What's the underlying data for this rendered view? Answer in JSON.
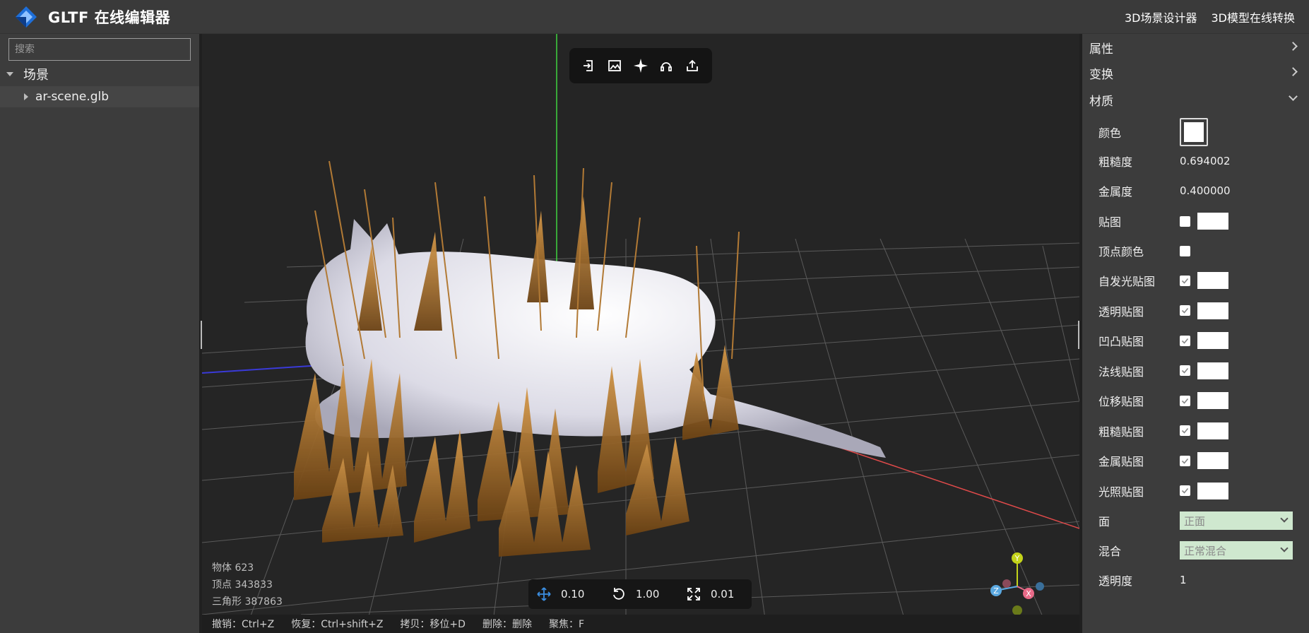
{
  "header": {
    "title": "GLTF 在线编辑器",
    "links": [
      "3D场景设计器",
      "3D模型在线转换"
    ]
  },
  "left_panel": {
    "search_placeholder": "搜索",
    "tree_root": "场景",
    "tree_child": "ar-scene.glb"
  },
  "viewport": {
    "toolbar_icons": [
      "import-icon",
      "image-upload-icon",
      "light-icon",
      "headset-icon",
      "export-icon"
    ],
    "stats": {
      "objects": "物体 623",
      "vertices": "顶点 343833",
      "triangles": "三角形 387863"
    },
    "snap": {
      "translate": "0.10",
      "rotate": "1.00",
      "scale": "0.01"
    },
    "shortcuts": [
      "撤销：Ctrl+Z",
      "恢复：Ctrl+shift+Z",
      "拷贝：移位+D",
      "删除：删除",
      "聚焦：F"
    ],
    "gizmo_labels": {
      "y": "Y",
      "z": "Z",
      "x": "X"
    },
    "axis_colors": {
      "x": "#e04a4a",
      "y": "#3fd43f",
      "z": "#3a3ad8"
    }
  },
  "right_panel": {
    "sections": {
      "attributes": "属性",
      "transform": "变换",
      "material": "材质"
    },
    "material": {
      "color_label": "颜色",
      "color_value": "#ffffff",
      "roughness_label": "粗糙度",
      "roughness_value": "0.694002",
      "metalness_label": "金属度",
      "metalness_value": "0.400000",
      "map_label": "贴图",
      "vertex_colors_label": "顶点颜色",
      "maps": [
        {
          "label": "自发光贴图"
        },
        {
          "label": "透明贴图"
        },
        {
          "label": "凹凸贴图"
        },
        {
          "label": "法线贴图"
        },
        {
          "label": "位移贴图"
        },
        {
          "label": "粗糙贴图"
        },
        {
          "label": "金属贴图"
        },
        {
          "label": "光照贴图"
        }
      ],
      "side_label": "面",
      "side_value": "正面",
      "blend_label": "混合",
      "blend_value": "正常混合",
      "opacity_label": "透明度",
      "opacity_value": "1"
    }
  }
}
